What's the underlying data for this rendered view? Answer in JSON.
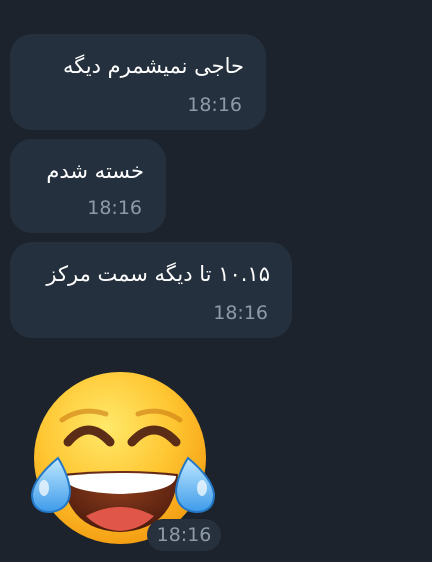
{
  "messages": [
    {
      "text": "حاجی نمیشمرم دیگه",
      "time": "18:16"
    },
    {
      "text": "خسته شدم",
      "time": "18:16"
    },
    {
      "text": "۱۰.۱۵ تا دیگه سمت مرکز",
      "time": "18:16"
    }
  ],
  "sticker": {
    "icon": "face-with-tears-of-joy-emoji",
    "time": "18:16"
  },
  "colors": {
    "background": "#1c232c",
    "bubble": "#24303d",
    "text": "#ffffff",
    "time": "#8e9aa8"
  }
}
